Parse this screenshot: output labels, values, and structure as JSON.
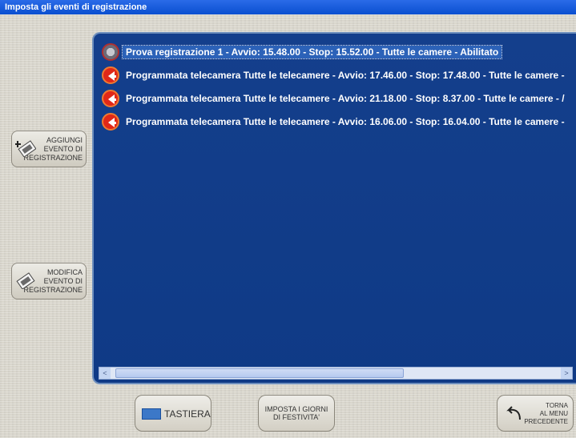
{
  "window": {
    "title": "Imposta gli eventi di registrazione"
  },
  "events": [
    {
      "icon": "disabled-event-icon",
      "text": "Prova registrazione 1 - Avvio: 15.48.00 - Stop: 15.52.00 - Tutte le camere - Abilitato",
      "selected": true
    },
    {
      "icon": "scheduled-event-icon",
      "text": "Programmata telecamera Tutte le telecamere - Avvio: 17.46.00 - Stop: 17.48.00 - Tutte le camere - ",
      "selected": false
    },
    {
      "icon": "scheduled-event-icon",
      "text": "Programmata telecamera Tutte le telecamere - Avvio: 21.18.00 - Stop: 8.37.00 - Tutte le camere - /",
      "selected": false
    },
    {
      "icon": "scheduled-event-icon",
      "text": "Programmata telecamera Tutte le telecamere - Avvio: 16.06.00 - Stop: 16.04.00 - Tutte le camere - ",
      "selected": false
    }
  ],
  "sidebar": {
    "add_event": [
      "AGGIUNGI",
      "EVENTO DI",
      "REGISTRAZIONE"
    ],
    "edit_event": [
      "MODIFICA",
      "EVENTO DI",
      "REGISTRAZIONE"
    ]
  },
  "bottom": {
    "keyboard": "TASTIERA",
    "holidays": [
      "IMPOSTA I GIORNI",
      "DI FESTIVITA'"
    ],
    "back": [
      "TORNA",
      "AL MENU",
      "PRECEDENTE"
    ]
  },
  "scroll": {
    "left_arrow": "<",
    "right_arrow": ">"
  },
  "colors": {
    "panel": "#103c8a",
    "title": "#0a4fd0",
    "event_icon": "#e02818"
  }
}
